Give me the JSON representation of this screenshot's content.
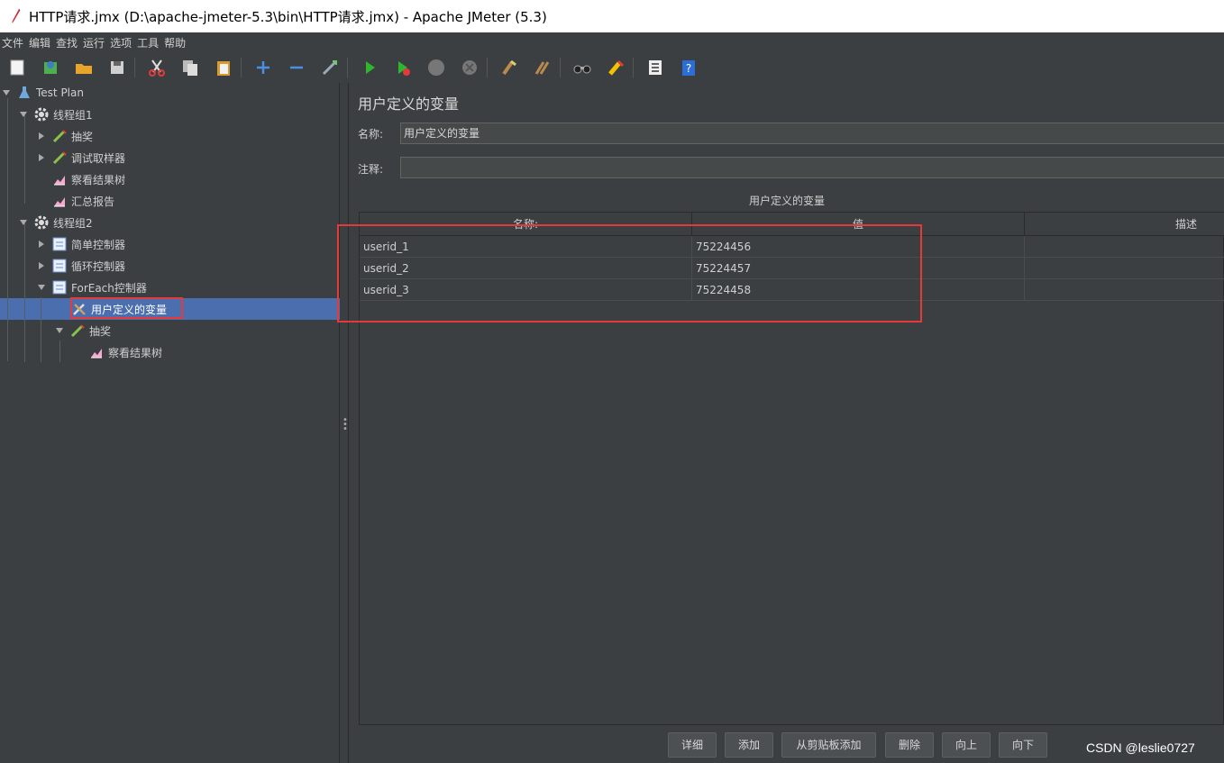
{
  "window": {
    "title": "HTTP请求.jmx (D:\\apache-jmeter-5.3\\bin\\HTTP请求.jmx) - Apache JMeter (5.3)"
  },
  "menu": [
    "文件",
    "编辑",
    "查找",
    "运行",
    "选项",
    "工具",
    "帮助"
  ],
  "toolbar": {
    "icons": [
      "new-icon",
      "templates-icon",
      "open-icon",
      "save-icon",
      "cut-icon",
      "copy-icon",
      "paste-icon",
      "expand-icon",
      "collapse-icon",
      "toggle-icon",
      "start-icon",
      "start-no-pause-icon",
      "stop-icon",
      "shutdown-icon",
      "clear-icon",
      "clear-all-icon",
      "search-icon",
      "reset-search-icon",
      "function-helper-icon",
      "help-icon"
    ]
  },
  "tree": {
    "nodes": [
      {
        "label": "Test Plan",
        "icon": "test-plan-icon"
      },
      {
        "label": "线程组1",
        "icon": "gear-icon"
      },
      {
        "label": "抽奖",
        "icon": "sampler-icon"
      },
      {
        "label": "调试取样器",
        "icon": "sampler-icon"
      },
      {
        "label": "察看结果树",
        "icon": "listener-icon"
      },
      {
        "label": "汇总报告",
        "icon": "listener-icon"
      },
      {
        "label": "线程组2",
        "icon": "gear-icon"
      },
      {
        "label": "简单控制器",
        "icon": "controller-icon"
      },
      {
        "label": "循环控制器",
        "icon": "controller-icon"
      },
      {
        "label": "ForEach控制器",
        "icon": "controller-icon"
      },
      {
        "label": "用户定义的变量",
        "icon": "config-element-icon"
      },
      {
        "label": "抽奖",
        "icon": "sampler-icon"
      },
      {
        "label": "察看结果树",
        "icon": "listener-icon"
      }
    ],
    "selected": "用户定义的变量"
  },
  "panel": {
    "title": "用户定义的变量",
    "name_label": "名称:",
    "name_value": "用户定义的变量",
    "comment_label": "注释:",
    "comment_value": "",
    "table_caption": "用户定义的变量",
    "columns": [
      "名称:",
      "值",
      "描述"
    ],
    "rows": [
      [
        "userid_1",
        "75224456",
        ""
      ],
      [
        "userid_2",
        "75224457",
        ""
      ],
      [
        "userid_3",
        "75224458",
        ""
      ]
    ],
    "buttons": [
      "详细",
      "添加",
      "从剪贴板添加",
      "删除",
      "向上",
      "向下"
    ]
  },
  "watermark": "CSDN @leslie0727",
  "colors": {
    "background": "#3c3f41",
    "selection": "#4b6eaf",
    "highlight": "#e63a3a"
  }
}
